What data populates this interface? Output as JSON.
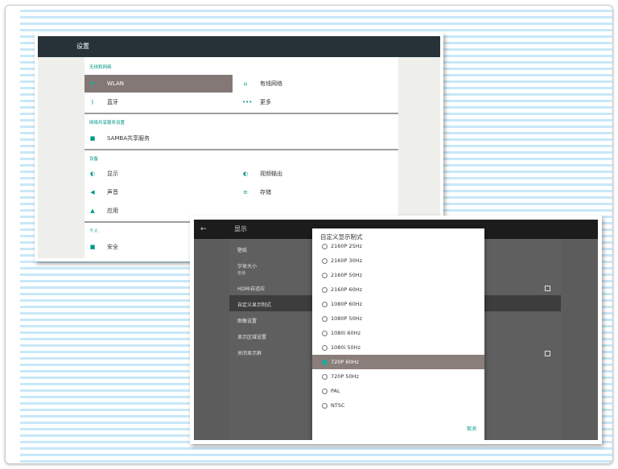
{
  "screen1": {
    "title": "设置",
    "section_wireless": "无线和网络",
    "wlan": "WLAN",
    "wired": "有线网络",
    "bluetooth": "蓝牙",
    "more": "更多",
    "section_share": "网络共享服务设置",
    "samba": "SAMBA共享服务",
    "section_device": "设备",
    "display": "显示",
    "video_output": "视频输出",
    "sound": "声音",
    "storage": "存储",
    "apps": "应用",
    "section_personal": "个人",
    "security": "安全"
  },
  "screen2": {
    "back_icon": "←",
    "title": "显示",
    "wallpaper": "壁纸",
    "font_size": "字体大小",
    "font_size_value": "普通",
    "hdmi_adapt": "HDMI自适应",
    "custom_display_mode": "自定义显示制式",
    "image_settings": "图像设置",
    "display_area": "显示区域设置",
    "screen_off": "关闭显示屏"
  },
  "dialog": {
    "title": "自定义显示制式",
    "options": [
      "2160P 25Hz",
      "2160P 30Hz",
      "2160P 50Hz",
      "2160P 60Hz",
      "1080P 60Hz",
      "1080P 50Hz",
      "1080i 60Hz",
      "1080i 50Hz",
      "720P 60Hz",
      "720P 50Hz",
      "PAL",
      "NTSC"
    ],
    "selected": "720P 60Hz",
    "cancel": "取消"
  },
  "colors": {
    "accent": "#009688",
    "toolbar1": "#263238",
    "selected_row": "#847876"
  },
  "icons": [
    "wifi-icon",
    "home-icon",
    "bluetooth-icon",
    "more-icon",
    "folder-icon",
    "brightness-icon",
    "volume-icon",
    "storage-icon",
    "android-icon",
    "lock-icon",
    "back-arrow-icon"
  ]
}
